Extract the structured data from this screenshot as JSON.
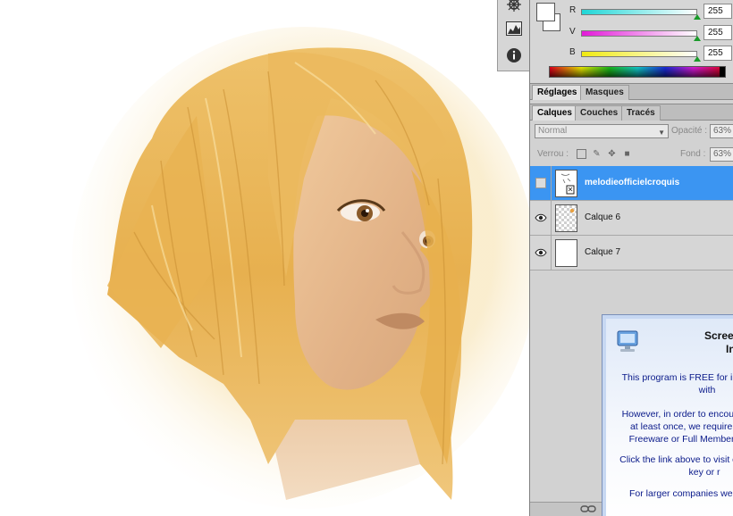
{
  "tool_strip": {
    "icons": [
      "compass-icon",
      "histogram-icon",
      "info-icon"
    ]
  },
  "color_panel": {
    "sliders": [
      {
        "label": "R",
        "value": "255",
        "track_from": "#1fd6d6",
        "track_to": "#ffffff"
      },
      {
        "label": "V",
        "value": "255",
        "track_from": "#e21ad8",
        "track_to": "#ffffff"
      },
      {
        "label": "B",
        "value": "255",
        "track_from": "#f0ea10",
        "track_to": "#ffffff"
      }
    ]
  },
  "adjust_tabs": [
    "Réglages",
    "Masques"
  ],
  "layer_tabs": [
    "Calques",
    "Couches",
    "Tracés"
  ],
  "layers_panel": {
    "blend_mode": "Normal",
    "opacity_label": "Opacité :",
    "opacity_value": "63%",
    "lock_label": "Verrou :",
    "fill_label": "Fond :",
    "fill_value": "63%",
    "layers": [
      {
        "name": "melodieofficielcroquis",
        "selected": true,
        "visible": false
      },
      {
        "name": "Calque 6",
        "selected": false,
        "visible": true
      },
      {
        "name": "Calque 7",
        "selected": false,
        "visible": true
      }
    ]
  },
  "dialog": {
    "title_line1": "Scree",
    "title_line2": "In",
    "lines": [
      "This program is FREE for inc",
      "with",
      "However, in order to encoura",
      "at least once, we require th",
      "Freeware or Full Member lic",
      "Click the link above to visit ou",
      "key or r",
      "For larger companies we off"
    ]
  },
  "colors": {
    "selection_blue": "#3b95f2",
    "panel_gray": "#d2d2d2",
    "hair_gold": "#e8b455",
    "skin": "#e6bb8c"
  }
}
